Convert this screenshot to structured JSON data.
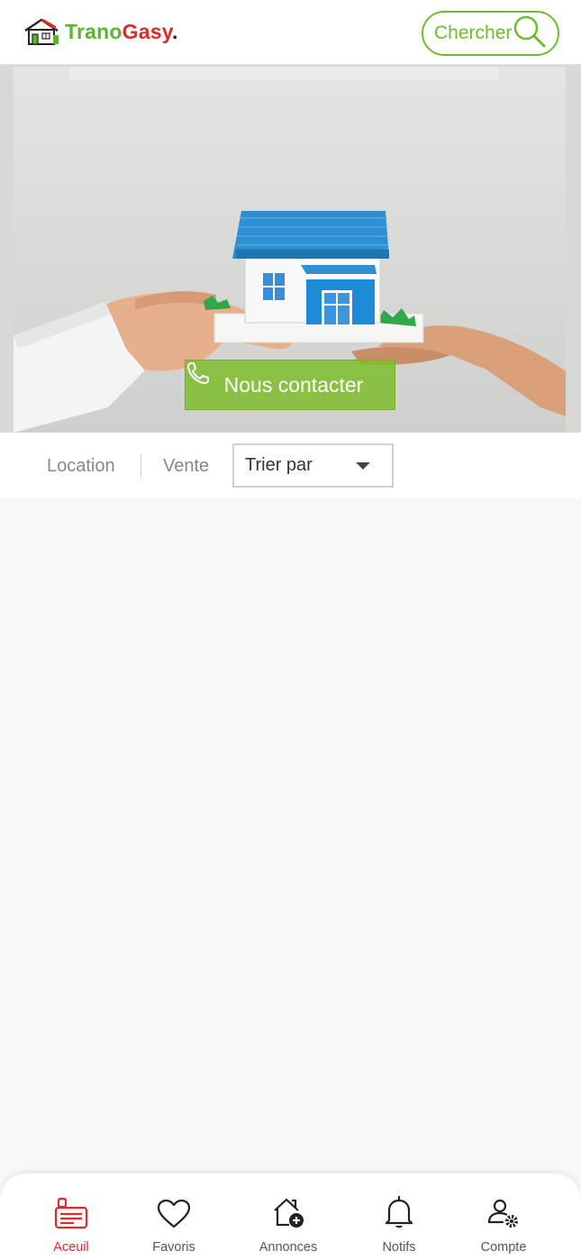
{
  "header": {
    "logo": {
      "part1": "Trano",
      "part2": "Gasy",
      "dot": "."
    },
    "search": {
      "label": "Chercher",
      "icon": "search-icon"
    }
  },
  "hero": {
    "contact_label": "Nous contacter",
    "contact_icon": "phone-icon"
  },
  "filters": {
    "tabs": [
      {
        "label": "Location"
      },
      {
        "label": "Vente"
      }
    ],
    "sort": {
      "label": "Trier par",
      "icon": "chevron-down-icon"
    }
  },
  "bottom_nav": {
    "items": [
      {
        "label": "Aceuil",
        "icon": "home-list-icon",
        "active": true
      },
      {
        "label": "Favoris",
        "icon": "heart-icon",
        "active": false
      },
      {
        "label": "Annonces",
        "icon": "house-add-icon",
        "active": false
      },
      {
        "label": "Notifs",
        "icon": "bell-icon",
        "active": false
      },
      {
        "label": "Compte",
        "icon": "user-settings-icon",
        "active": false
      }
    ]
  },
  "colors": {
    "brand_green": "#6dbd2c",
    "brand_red": "#e22a2a",
    "background": "#f8f8f8"
  }
}
